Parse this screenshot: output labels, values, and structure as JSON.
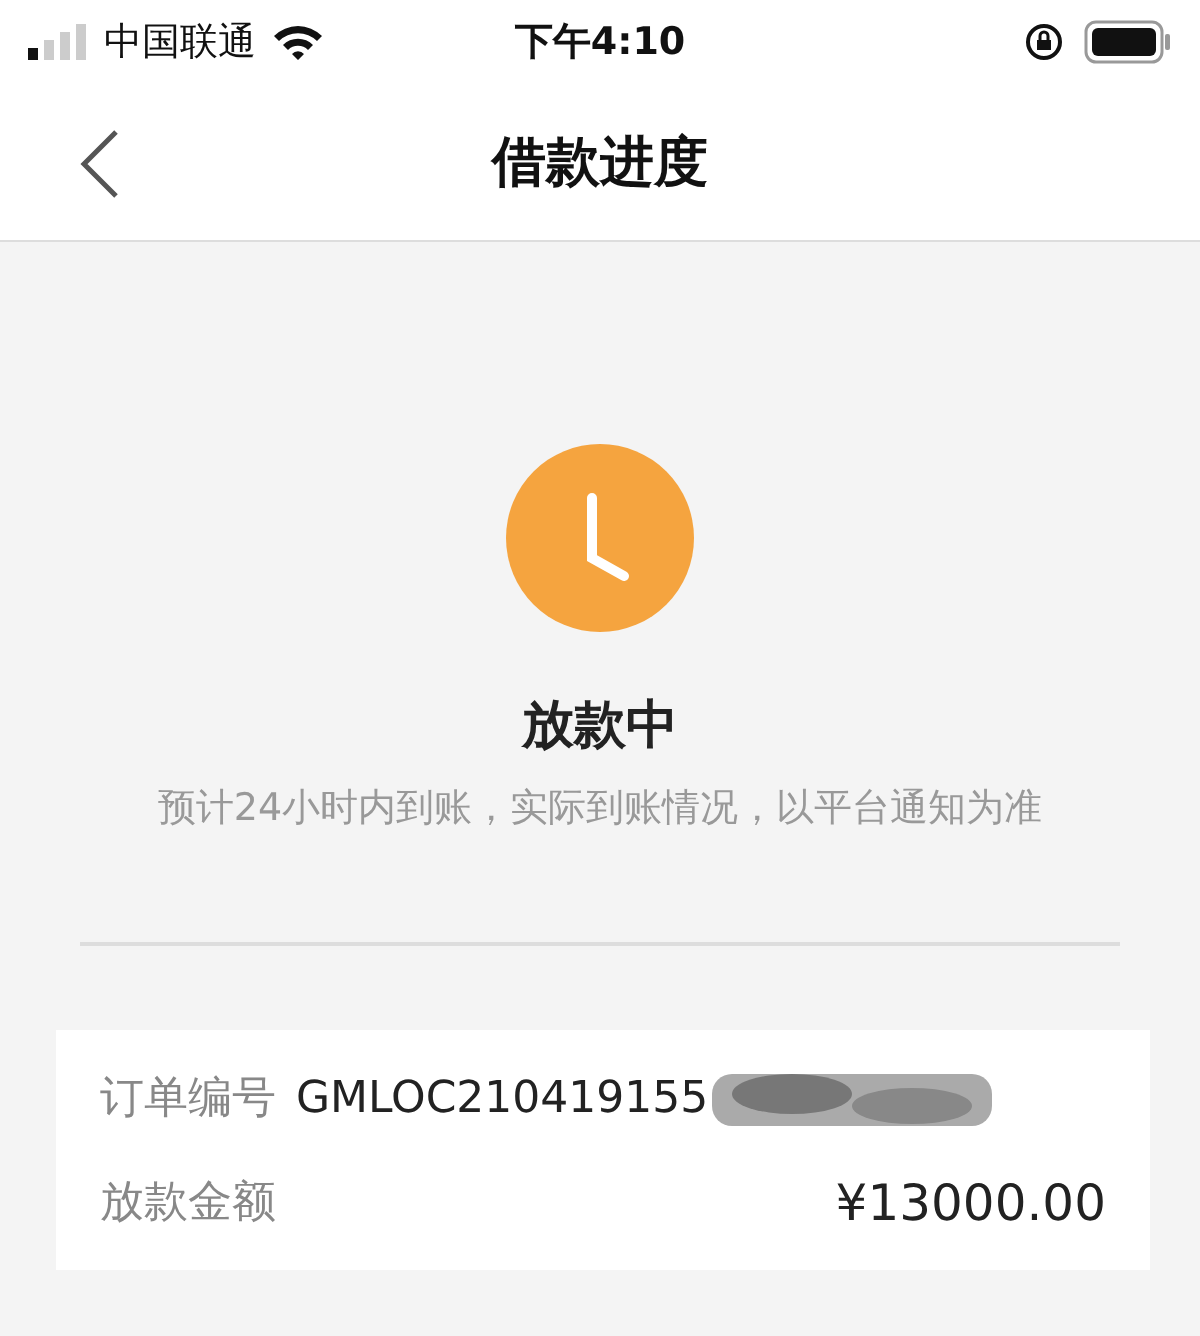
{
  "status_bar": {
    "carrier": "中国联通",
    "time": "下午4:10"
  },
  "nav": {
    "title": "借款进度"
  },
  "status": {
    "title": "放款中",
    "note": "预计24小时内到账，实际到账情况，以平台通知为准"
  },
  "details": [
    {
      "label": "订单编号",
      "value": "GMLOC210419155",
      "redacted": true
    },
    {
      "label": "放款金额",
      "value": "¥13000.00"
    }
  ]
}
